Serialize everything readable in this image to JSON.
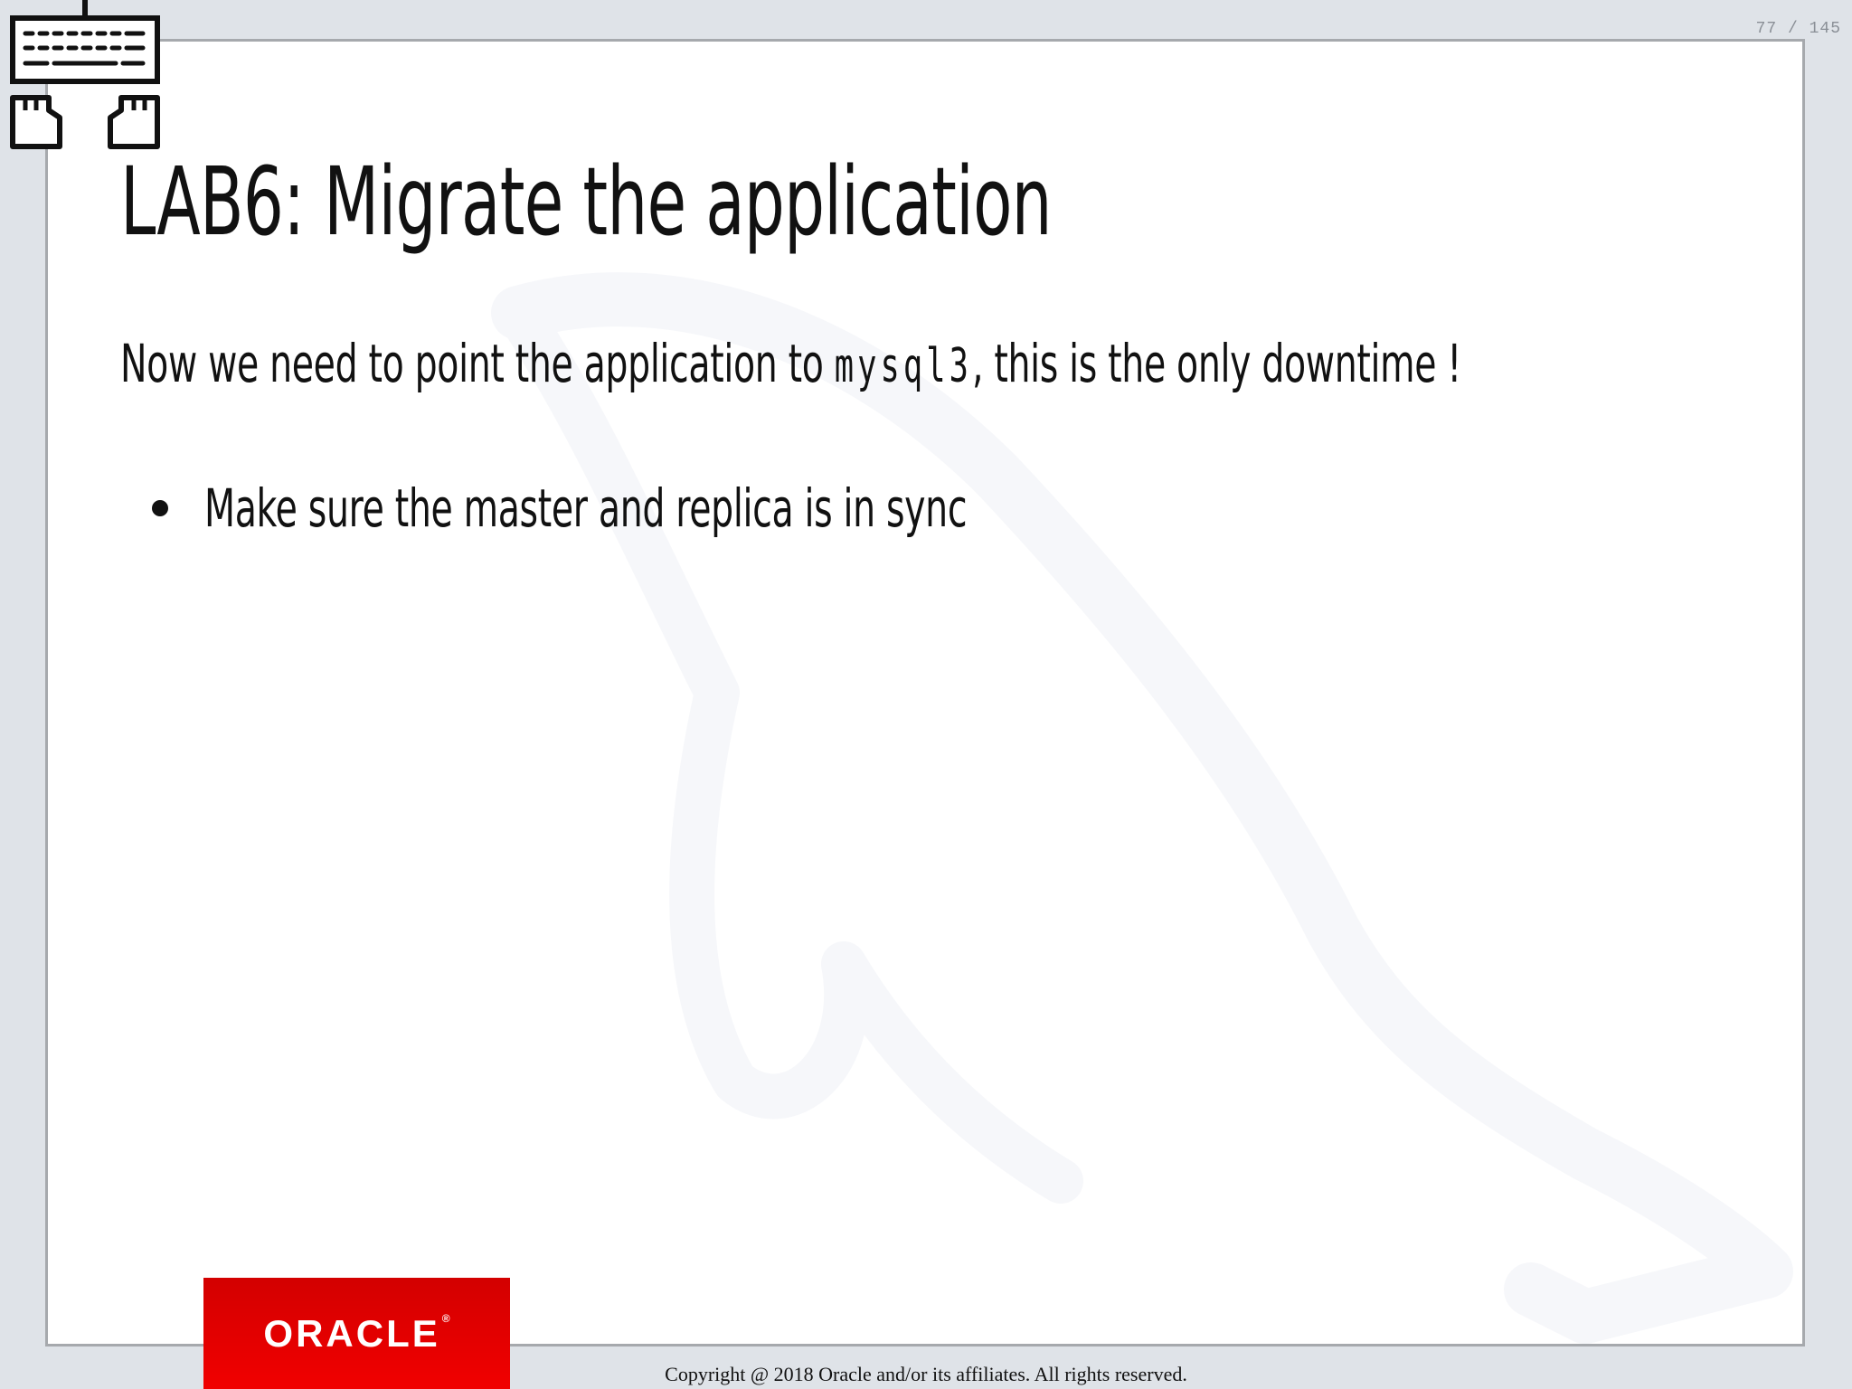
{
  "viewer": {
    "page_counter": "77 / 145"
  },
  "slide": {
    "title": "LAB6: Migrate the application",
    "body_before_code": "Now we need to point the application to ",
    "body_code": "mysql3",
    "body_after_code": ", this is the only downtime !",
    "bullets": [
      "Make sure the master and replica is in sync"
    ]
  },
  "footer": {
    "logo_text": "ORACLE",
    "logo_mark": "®",
    "copyright": "Copyright @ 2018 Oracle and/or its affiliates. All rights reserved."
  },
  "icons": {
    "keyboard": "keyboard-hands-icon",
    "watermark": "dolphin-watermark-icon"
  },
  "colors": {
    "background": "#dfe3e8",
    "slide_border": "#a6a9ad",
    "oracle_red": "#e60000",
    "text": "#111111"
  }
}
